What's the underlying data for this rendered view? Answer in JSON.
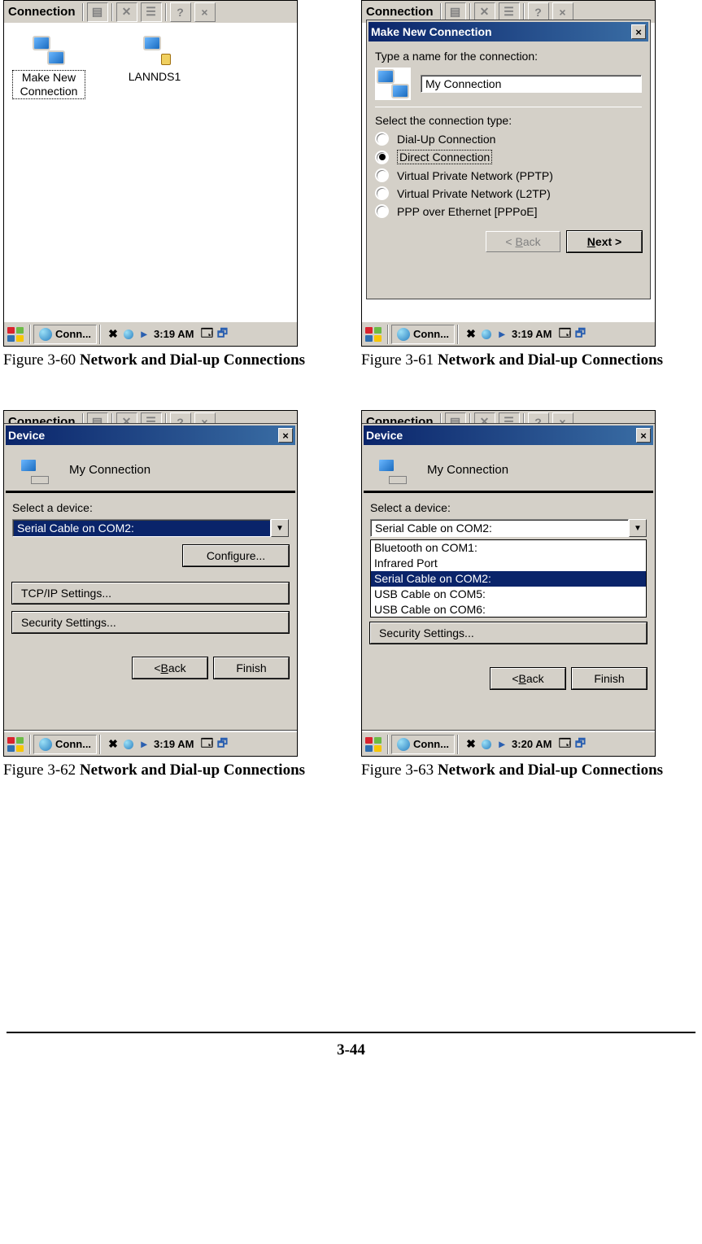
{
  "page_number": "3-44",
  "common": {
    "toolbar_title": "Connection",
    "taskbar_app": "Conn...",
    "caption_bold": "Network and Dial-up Connections"
  },
  "fig60": {
    "caption_prefix": "Figure 3-60 ",
    "icon1_label": "Make New Connection",
    "icon2_label": "LANNDS1",
    "time": "3:19 AM"
  },
  "fig61": {
    "caption_prefix": "Figure 3-61 ",
    "dlg_title": "Make New Connection",
    "label1": "Type a name for the connection:",
    "input_value": "My Connection",
    "label2": "Select the connection type:",
    "radio1": "Dial-Up Connection",
    "radio2": "Direct Connection",
    "radio3": "Virtual Private Network (PPTP)",
    "radio4": "Virtual Private Network (L2TP)",
    "radio5": "PPP over Ethernet [PPPoE]",
    "back": "< Back",
    "next": "Next >",
    "time": "3:19 AM"
  },
  "fig62": {
    "caption_prefix": "Figure 3-62 ",
    "dlg_title": "Device",
    "conn_name": "My Connection",
    "label1": "Select a device:",
    "selected": "Serial Cable on COM2:",
    "configure": "Configure...",
    "tcpip": "TCP/IP Settings...",
    "security": "Security Settings...",
    "back": "< Back",
    "finish": "Finish",
    "time": "3:19 AM"
  },
  "fig63": {
    "caption_prefix": "Figure 3-63 ",
    "dlg_title": "Device",
    "conn_name": "My Connection",
    "label1": "Select a device:",
    "selected": "Serial Cable on COM2:",
    "opt1": "Bluetooth on COM1:",
    "opt2": "Infrared Port",
    "opt3": "Serial Cable on COM2:",
    "opt4": "USB Cable on COM5:",
    "opt5": "USB Cable on COM6:",
    "security": "Security Settings...",
    "back": "< Back",
    "finish": "Finish",
    "time": "3:20 AM"
  }
}
